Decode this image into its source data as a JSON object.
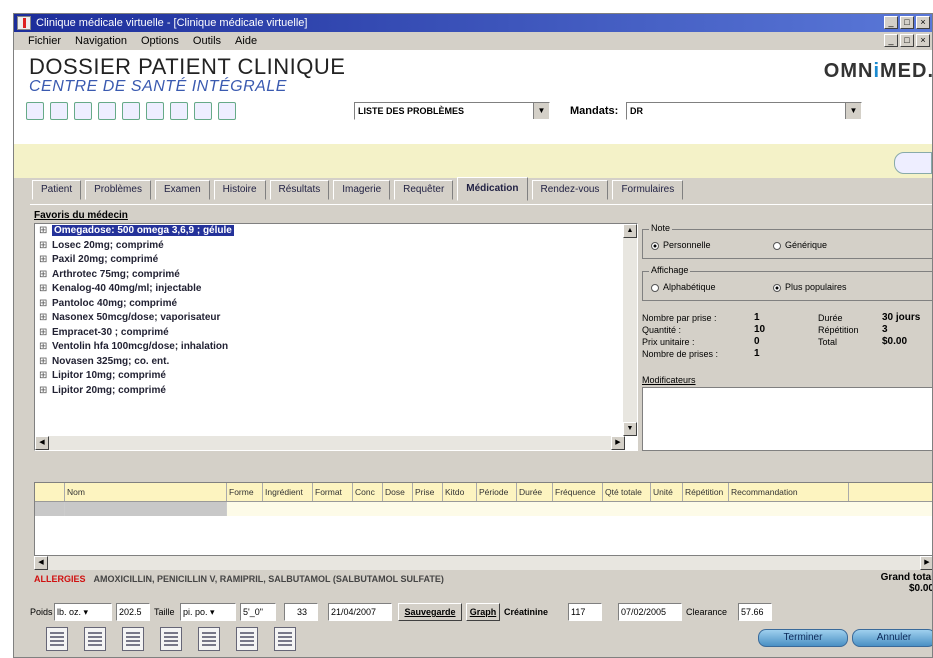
{
  "window": {
    "title": "Clinique médicale virtuelle - [Clinique médicale virtuelle]",
    "controls": [
      "_",
      "□",
      "×"
    ]
  },
  "menu": [
    "Fichier",
    "Navigation",
    "Options",
    "Outils",
    "Aide"
  ],
  "header": {
    "title": "DOSSIER PATIENT CLINIQUE",
    "subtitle": "CENTRE DE SANTÉ INTÉGRALE",
    "logo_left": "OMN",
    "logo_mid": "i",
    "logo_right": "MED."
  },
  "toolbar": {
    "problem_list": "LISTE DES PROBLÈMES",
    "mandat_label": "Mandats:",
    "mandat_value": "DR"
  },
  "tabs": [
    "Patient",
    "Problèmes",
    "Examen",
    "Histoire",
    "Résultats",
    "Imagerie",
    "Requêter",
    "Médication",
    "Rendez-vous",
    "Formulaires"
  ],
  "active_tab": "Médication",
  "favorites": {
    "label": "Favoris du médecin",
    "items": [
      "Omegadose: 500 omega 3,6,9 ; gélule",
      "Losec 20mg; comprimé",
      "Paxil 20mg; comprimé",
      "Arthrotec 75mg; comprimé",
      "Kenalog-40 40mg/ml; injectable",
      "Pantoloc 40mg; comprimé",
      "Nasonex 50mcg/dose; vaporisateur",
      "Empracet-30 ; comprimé",
      "Ventolin hfa 100mcg/dose; inhalation",
      "Novasen 325mg; co. ent.",
      "Lipitor 10mg; comprimé",
      "Lipitor 20mg; comprimé"
    ]
  },
  "note_group": {
    "label": "Note",
    "options": [
      "Personnelle",
      "Générique"
    ],
    "selected": "Personnelle"
  },
  "display_group": {
    "label": "Affichage",
    "options": [
      "Alphabétique",
      "Plus populaires"
    ],
    "selected": "Plus populaires"
  },
  "dosage": {
    "rows": [
      {
        "label": "Nombre par prise :",
        "value": "1",
        "label2": "Durée",
        "value2": "30 jours"
      },
      {
        "label": "Quantité :",
        "value": "10",
        "label2": "Répétition",
        "value2": "3"
      },
      {
        "label": "Prix unitaire :",
        "value": "0",
        "label2": "Total",
        "value2": "$0.00"
      },
      {
        "label": "Nombre de prises :",
        "value": "1",
        "label2": "",
        "value2": ""
      }
    ],
    "modifiers_label": "Modificateurs"
  },
  "grid": {
    "columns": [
      "Nom",
      "Forme",
      "Ingrédient",
      "Format",
      "Conc",
      "Dose",
      "Prise",
      "Kitdo",
      "Période",
      "Durée",
      "Fréquence",
      "Qté totale",
      "Unité",
      "Répétition",
      "Recommandation"
    ]
  },
  "allergies": {
    "label": "ALLERGIES",
    "text": "AMOXICILLIN, PENICILLIN V, RAMIPRIL, SALBUTAMOL (SALBUTAMOL SULFATE)"
  },
  "grand_total": {
    "label": "Grand total",
    "value": "$0.00"
  },
  "bottom": {
    "poids_label": "Poids",
    "poids_unit": "lb. oz.",
    "poids_value": "202.5",
    "taille_label": "Taille",
    "taille_unit": "pi. po.",
    "taille_value": "5'_0\"",
    "age": "33",
    "date1": "21/04/2007",
    "save_btn": "Sauvegarde",
    "graph_btn": "Graph",
    "creat_label": "Créatinine",
    "creat_value": "117",
    "date2": "07/02/2005",
    "clearance_label": "Clearance",
    "clearance_value": "57.66",
    "terminer": "Terminer",
    "annuler": "Annuler"
  }
}
